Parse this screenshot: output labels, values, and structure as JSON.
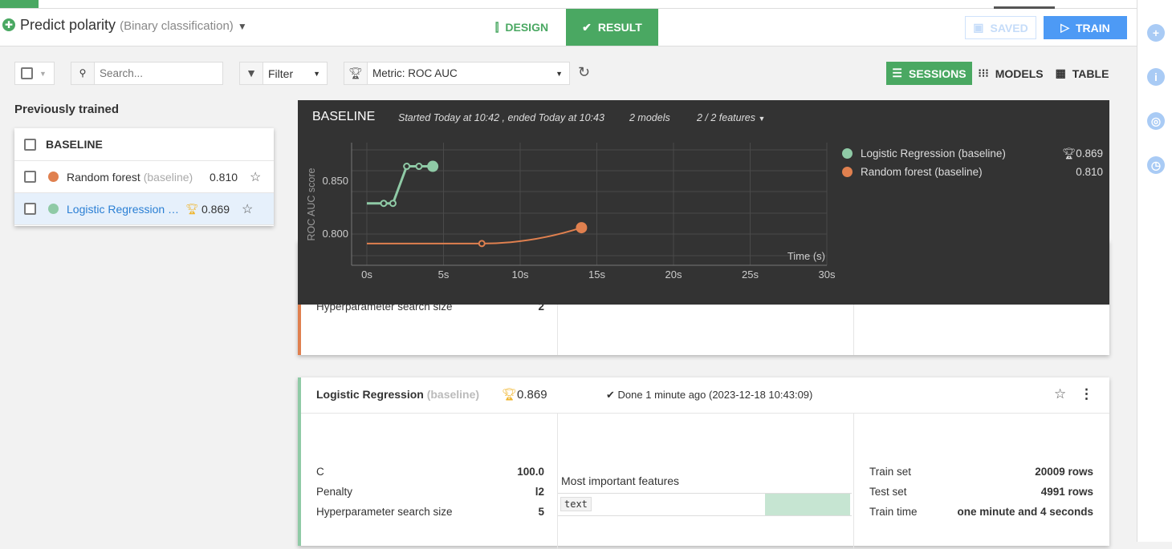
{
  "header": {
    "title": "Predict polarity",
    "subtitle": "(Binary classification)",
    "tabs": [
      {
        "label": "DESIGN",
        "active": false
      },
      {
        "label": "RESULT",
        "active": true
      }
    ],
    "saved_label": "SAVED",
    "train_label": "TRAIN"
  },
  "toolbar": {
    "search_placeholder": "Search...",
    "filter_label": "Filter",
    "metric_label": "Metric: ROC AUC",
    "views": [
      "SESSIONS",
      "MODELS",
      "TABLE"
    ],
    "active_view": "SESSIONS"
  },
  "sidebar": {
    "heading": "Previously trained",
    "session": "BASELINE",
    "models": [
      {
        "name": "Random forest",
        "tag": "(baseline)",
        "score": "0.810",
        "color": "#e0804f",
        "best": false
      },
      {
        "name": "Logistic Regression …",
        "tag": "",
        "score": "0.869",
        "color": "#8fcaa6",
        "best": true
      }
    ]
  },
  "session_panel": {
    "title": "BASELINE",
    "time": "Started Today at 10:42 , ended Today at 10:43",
    "models_count": "2 models",
    "features": "2 / 2 features",
    "legend": [
      {
        "name": "Logistic Regression (baseline)",
        "score": "0.869",
        "best": true,
        "color": "#8fcaa6"
      },
      {
        "name": "Random forest (baseline)",
        "score": "0.810",
        "best": false,
        "color": "#e0804f"
      }
    ]
  },
  "chart_data": {
    "type": "line",
    "xlabel": "Time (s)",
    "ylabel": "ROC AUC score",
    "x_ticks": [
      "0s",
      "5s",
      "10s",
      "15s",
      "20s",
      "25s",
      "30s"
    ],
    "y_ticks": [
      "0.800",
      "0.850"
    ],
    "xlim": [
      0,
      30
    ],
    "grid": true,
    "series": [
      {
        "name": "Logistic Regression (baseline)",
        "color": "#8fcaa6",
        "x": [
          0,
          1.1,
          1.7,
          2.6,
          3.4,
          4.3
        ],
        "y": [
          0.829,
          0.829,
          0.829,
          0.864,
          0.864,
          0.864
        ]
      },
      {
        "name": "Random forest (baseline)",
        "color": "#e0804f",
        "x": [
          0,
          7.5,
          14
        ],
        "y": [
          0.791,
          0.791,
          0.806
        ]
      }
    ]
  },
  "card_rf": {
    "params": [
      {
        "label": "Hyperparameter search size",
        "value": "2"
      }
    ]
  },
  "card_lr": {
    "name": "Logistic Regression",
    "tag": "(baseline)",
    "score": "0.869",
    "status": "Done 1 minute ago (2023-12-18 10:43:09)",
    "params": [
      {
        "label": "C",
        "value": "100.0"
      },
      {
        "label": "Penalty",
        "value": "l2"
      },
      {
        "label": "Hyperparameter search size",
        "value": "5"
      }
    ],
    "features_title": "Most important features",
    "features": [
      {
        "name": "text",
        "importance": 1.0
      }
    ],
    "info": [
      {
        "label": "Train set",
        "value": "20009 rows"
      },
      {
        "label": "Test set",
        "value": "4991 rows"
      },
      {
        "label": "Train time",
        "value": "one minute and 4 seconds"
      }
    ]
  }
}
